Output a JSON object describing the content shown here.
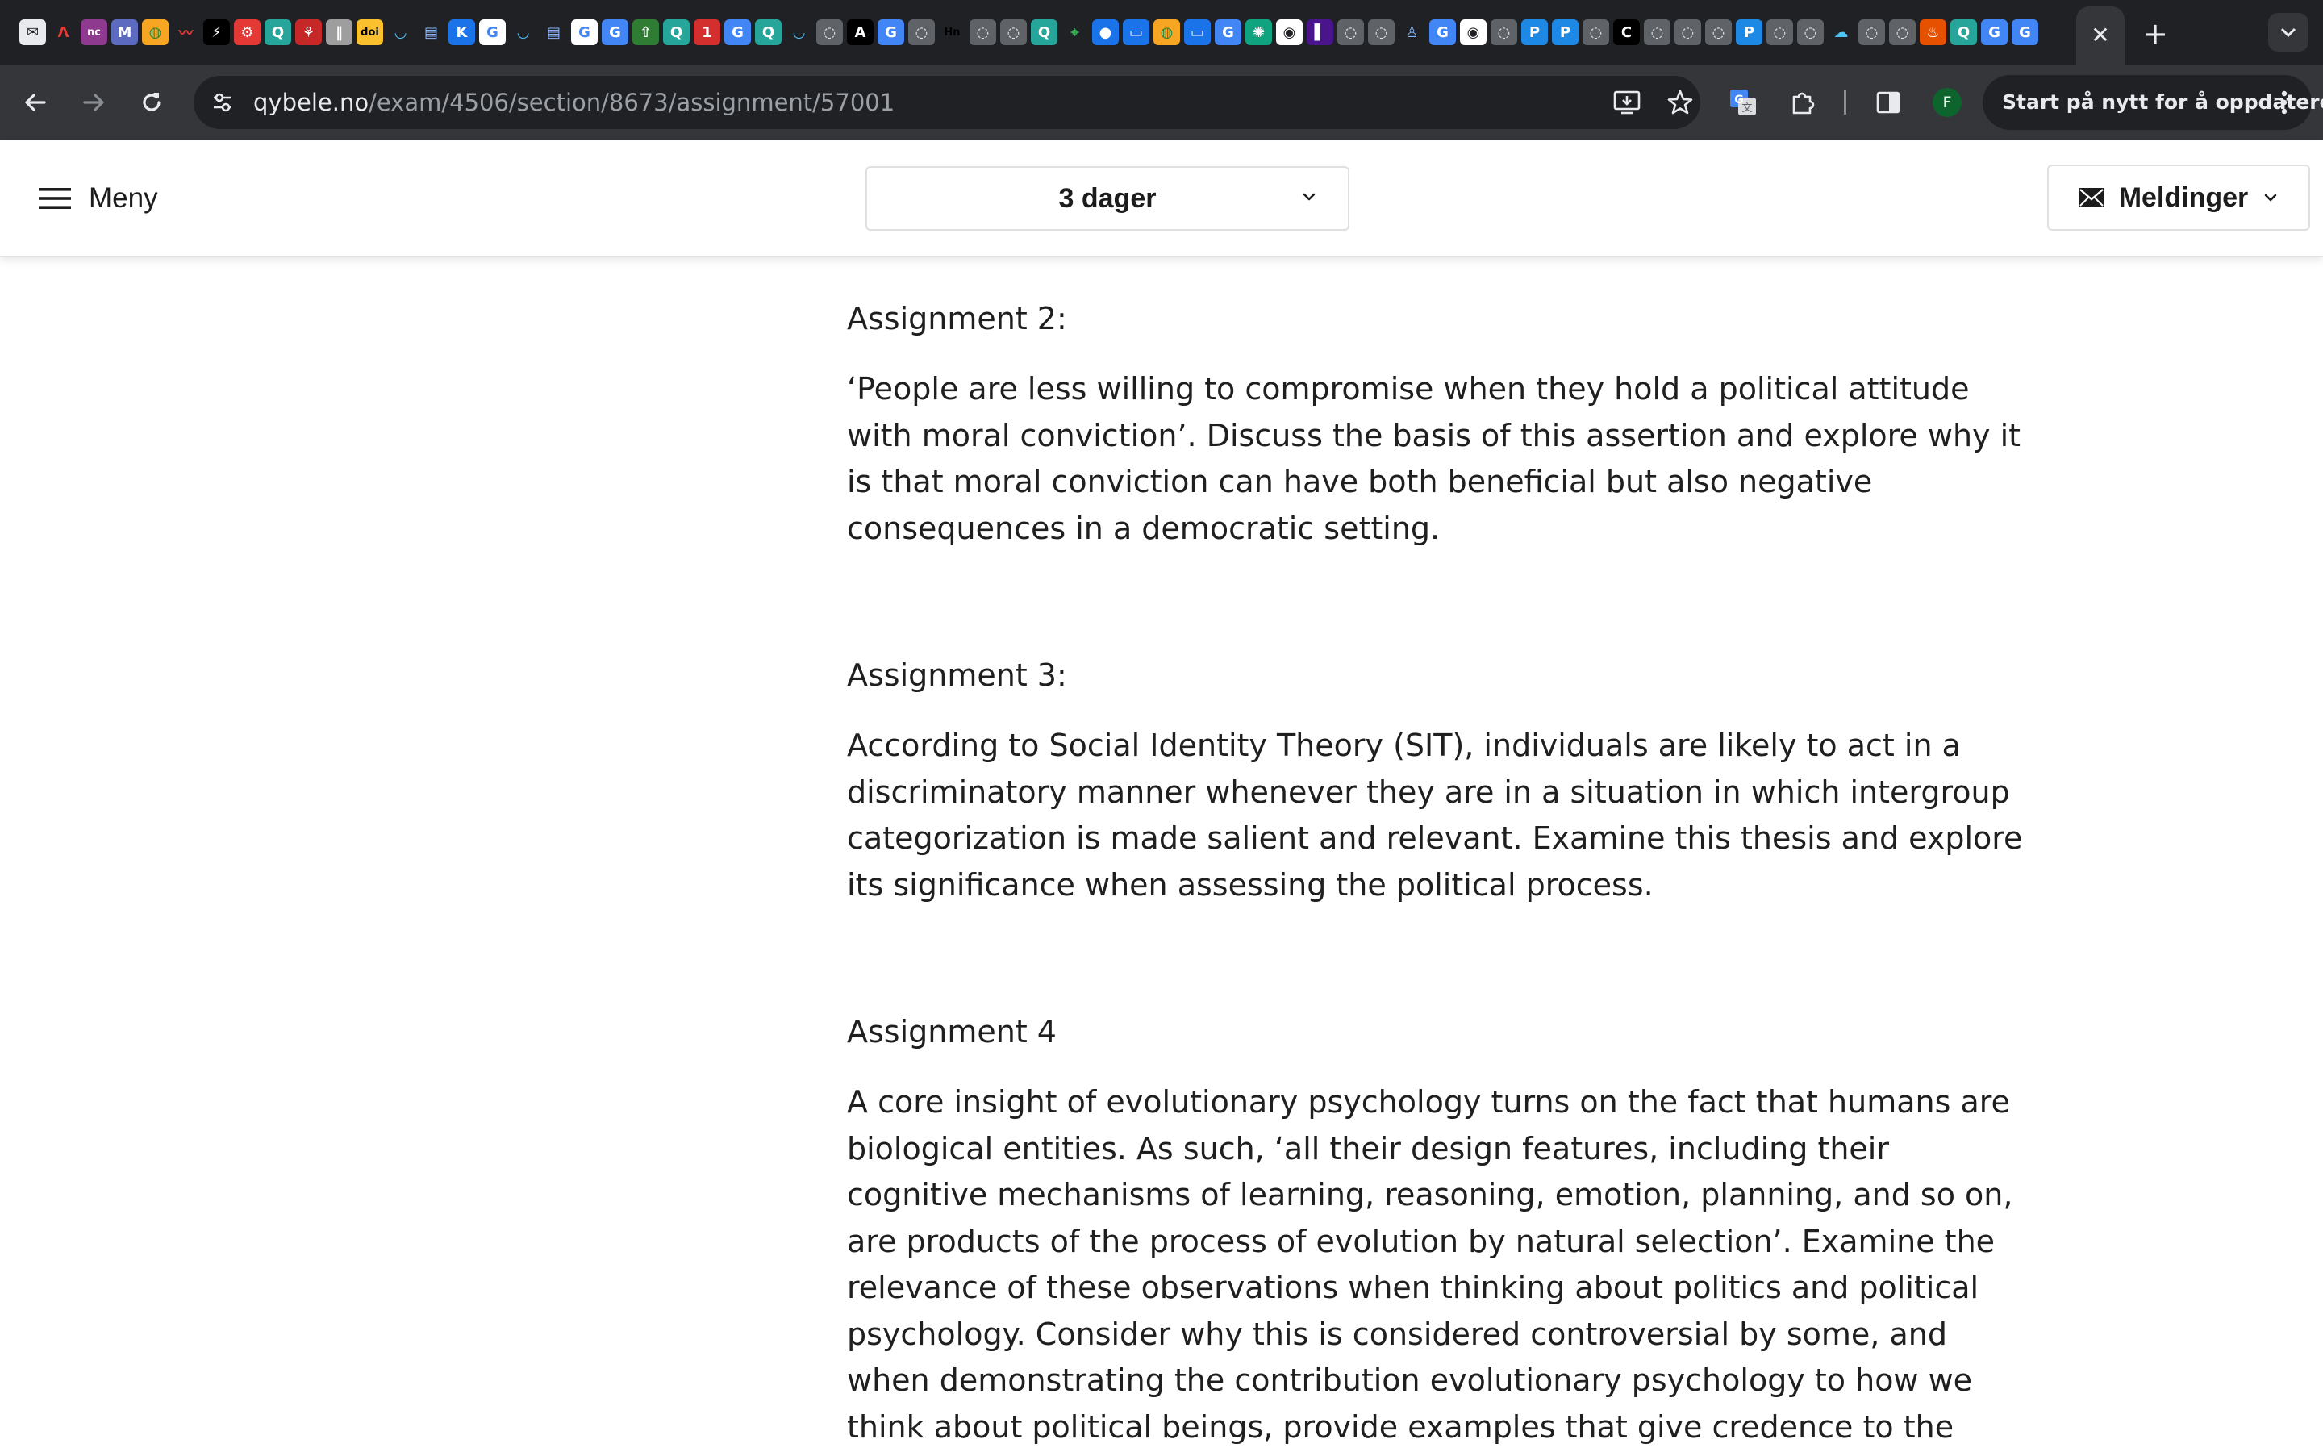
{
  "browser": {
    "url_host": "qybele.no",
    "url_path": "/exam/4506/section/8673/assignment/57001",
    "restart_label": "Start på nytt for å oppdatere",
    "profile_initial": "F",
    "tab_favicons": [
      {
        "glyph": "✉",
        "bg": "#e8eaed",
        "fg": "#202124"
      },
      {
        "glyph": "Λ",
        "bg": "#1f2124",
        "fg": "#e53935"
      },
      {
        "glyph": "nc",
        "bg": "#8e3a8e",
        "fg": "#ffffff"
      },
      {
        "glyph": "M",
        "bg": "#5c6bc0",
        "fg": "#ffffff"
      },
      {
        "glyph": "◍",
        "bg": "#f6a623",
        "fg": "#2e7d32"
      },
      {
        "glyph": "〰",
        "bg": "#1f2124",
        "fg": "#e53935"
      },
      {
        "glyph": "⚡",
        "bg": "#000000",
        "fg": "#ffffff"
      },
      {
        "glyph": "⚙",
        "bg": "#e53935",
        "fg": "#ffffff"
      },
      {
        "glyph": "Q",
        "bg": "#26a69a",
        "fg": "#ffffff"
      },
      {
        "glyph": "⚘",
        "bg": "#c62828",
        "fg": "#ffffff"
      },
      {
        "glyph": "‖",
        "bg": "#9e9e9e",
        "fg": "#ffffff"
      },
      {
        "glyph": "doi",
        "bg": "#fbc02d",
        "fg": "#000000"
      },
      {
        "glyph": "◡",
        "bg": "#1f2124",
        "fg": "#4fc3f7"
      },
      {
        "glyph": "▤",
        "bg": "#1f2124",
        "fg": "#8ab4f8"
      },
      {
        "glyph": "K",
        "bg": "#1a73e8",
        "fg": "#ffffff"
      },
      {
        "glyph": "G",
        "bg": "#ffffff",
        "fg": "#4285f4"
      },
      {
        "glyph": "◡",
        "bg": "#1f2124",
        "fg": "#4fc3f7"
      },
      {
        "glyph": "▤",
        "bg": "#1f2124",
        "fg": "#8ab4f8"
      },
      {
        "glyph": "G",
        "bg": "#ffffff",
        "fg": "#4285f4"
      },
      {
        "glyph": "G",
        "bg": "#4285f4",
        "fg": "#ffffff"
      },
      {
        "glyph": "⇧",
        "bg": "#2e7d32",
        "fg": "#ffffff"
      },
      {
        "glyph": "Q",
        "bg": "#26a69a",
        "fg": "#ffffff"
      },
      {
        "glyph": "1",
        "bg": "#d32f2f",
        "fg": "#ffffff"
      },
      {
        "glyph": "G",
        "bg": "#4285f4",
        "fg": "#ffffff"
      },
      {
        "glyph": "Q",
        "bg": "#26a69a",
        "fg": "#ffffff"
      },
      {
        "glyph": "◡",
        "bg": "#1f2124",
        "fg": "#4fc3f7"
      },
      {
        "glyph": "◌",
        "bg": "#5f6368",
        "fg": "#e8eaed"
      },
      {
        "glyph": "A",
        "bg": "#000000",
        "fg": "#ffffff"
      },
      {
        "glyph": "G",
        "bg": "#4285f4",
        "fg": "#ffffff"
      },
      {
        "glyph": "◌",
        "bg": "#5f6368",
        "fg": "#e8eaed"
      },
      {
        "glyph": "Hn",
        "bg": "#1f2124",
        "fg": "#000000"
      },
      {
        "glyph": "◌",
        "bg": "#5f6368",
        "fg": "#e8eaed"
      },
      {
        "glyph": "◌",
        "bg": "#5f6368",
        "fg": "#e8eaed"
      },
      {
        "glyph": "Q",
        "bg": "#26a69a",
        "fg": "#ffffff"
      },
      {
        "glyph": "⌖",
        "bg": "#1f2124",
        "fg": "#34a853"
      },
      {
        "glyph": "●",
        "bg": "#1a73e8",
        "fg": "#ffffff"
      },
      {
        "glyph": "▭",
        "bg": "#1a73e8",
        "fg": "#ffffff"
      },
      {
        "glyph": "◍",
        "bg": "#f6a623",
        "fg": "#2e7d32"
      },
      {
        "glyph": "▭",
        "bg": "#1a73e8",
        "fg": "#ffffff"
      },
      {
        "glyph": "G",
        "bg": "#4285f4",
        "fg": "#ffffff"
      },
      {
        "glyph": "✺",
        "bg": "#10a37f",
        "fg": "#ffffff"
      },
      {
        "glyph": "◉",
        "bg": "#ffffff",
        "fg": "#202124"
      },
      {
        "glyph": "▌",
        "bg": "#4a148c",
        "fg": "#ffffff"
      },
      {
        "glyph": "◌",
        "bg": "#5f6368",
        "fg": "#e8eaed"
      },
      {
        "glyph": "◌",
        "bg": "#5f6368",
        "fg": "#e8eaed"
      },
      {
        "glyph": "♙",
        "bg": "#1f2124",
        "fg": "#8ab4f8"
      },
      {
        "glyph": "G",
        "bg": "#4285f4",
        "fg": "#ffffff"
      },
      {
        "glyph": "◉",
        "bg": "#ffffff",
        "fg": "#202124"
      },
      {
        "glyph": "◌",
        "bg": "#5f6368",
        "fg": "#e8eaed"
      },
      {
        "glyph": "P",
        "bg": "#1e88e5",
        "fg": "#ffffff"
      },
      {
        "glyph": "P",
        "bg": "#1e88e5",
        "fg": "#ffffff"
      },
      {
        "glyph": "◌",
        "bg": "#5f6368",
        "fg": "#e8eaed"
      },
      {
        "glyph": "C",
        "bg": "#000000",
        "fg": "#ffffff"
      },
      {
        "glyph": "◌",
        "bg": "#5f6368",
        "fg": "#e8eaed"
      },
      {
        "glyph": "◌",
        "bg": "#5f6368",
        "fg": "#e8eaed"
      },
      {
        "glyph": "◌",
        "bg": "#5f6368",
        "fg": "#e8eaed"
      },
      {
        "glyph": "P",
        "bg": "#1e88e5",
        "fg": "#ffffff"
      },
      {
        "glyph": "◌",
        "bg": "#5f6368",
        "fg": "#e8eaed"
      },
      {
        "glyph": "◌",
        "bg": "#5f6368",
        "fg": "#e8eaed"
      },
      {
        "glyph": "☁",
        "bg": "#1f2124",
        "fg": "#4fc3f7"
      },
      {
        "glyph": "◌",
        "bg": "#5f6368",
        "fg": "#e8eaed"
      },
      {
        "glyph": "◌",
        "bg": "#5f6368",
        "fg": "#e8eaed"
      },
      {
        "glyph": "♨",
        "bg": "#e65100",
        "fg": "#ffffff"
      },
      {
        "glyph": "Q",
        "bg": "#26a69a",
        "fg": "#ffffff"
      },
      {
        "glyph": "G",
        "bg": "#4285f4",
        "fg": "#ffffff"
      },
      {
        "glyph": "G",
        "bg": "#4285f4",
        "fg": "#ffffff"
      }
    ]
  },
  "header": {
    "menu_label": "Meny",
    "time_remaining": "3 dager",
    "messages_label": "Meldinger"
  },
  "assignments": [
    {
      "title": "Assignment 2:",
      "text": "‘People are less willing to compromise when they hold a political attitude with moral conviction’. Discuss the basis of this assertion and explore why it is that moral conviction can have both beneficial but also negative consequences in a democratic setting."
    },
    {
      "title": "Assignment 3:",
      "text": "According to Social Identity Theory (SIT), individuals are likely to act in a discriminatory manner whenever they are in a situation in which intergroup categorization is made salient and relevant. Examine this thesis and explore its significance when assessing the political process."
    },
    {
      "title": "Assignment 4",
      "text": "A core insight of evolutionary psychology turns on the fact that humans are biological entities. As such, ‘all their design features, including their cognitive mechanisms of learning, reasoning, emotion, planning, and so on, are products of the process of evolution by natural selection’. Examine the relevance of these observations when thinking about politics and political psychology. Consider why this is considered controversial by some, and when demonstrating the contribution evolutionary psychology to how we think about political beings, provide examples that give credence to the assertion that it matters that we are"
    }
  ],
  "colors": {
    "tabstrip_bg": "#1f2124",
    "toolbar_bg": "#35363a",
    "omnibox_bg": "#202124",
    "page_bg": "#ffffff",
    "text": "#1f1f1f"
  }
}
